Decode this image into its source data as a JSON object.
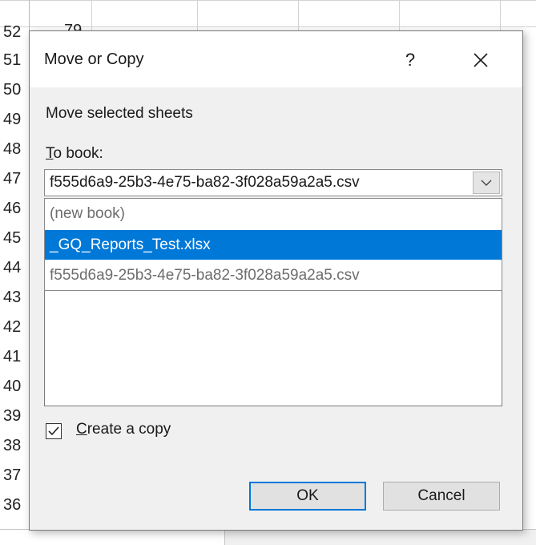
{
  "spreadsheet": {
    "row_numbers": [
      "52",
      "51",
      "50",
      "49",
      "48",
      "47",
      "46",
      "45",
      "44",
      "43",
      "42",
      "41",
      "40",
      "39",
      "38",
      "37",
      "36"
    ],
    "visible_cell_value": "79"
  },
  "dialog": {
    "title": "Move or Copy",
    "help_label": "?",
    "close_icon": "close-icon",
    "move_label": "Move selected sheets",
    "to_book_label_first": "T",
    "to_book_label_rest": "o book:",
    "combo_value": "f555d6a9-25b3-4e75-ba82-3f028a59a2a5.csv",
    "dropdown_items": [
      {
        "label": "(new book)",
        "selected": false
      },
      {
        "label": "_GQ_Reports_Test.xlsx",
        "selected": true
      },
      {
        "label": "f555d6a9-25b3-4e75-ba82-3f028a59a2a5.csv",
        "selected": false
      }
    ],
    "create_copy_checked": true,
    "create_copy_label_first": "C",
    "create_copy_label_rest": "reate a copy",
    "ok_label": "OK",
    "cancel_label": "Cancel"
  },
  "colors": {
    "selection": "#0078d7",
    "dialog_bg": "#f0f0f0",
    "grid": "#d4d4d4"
  }
}
